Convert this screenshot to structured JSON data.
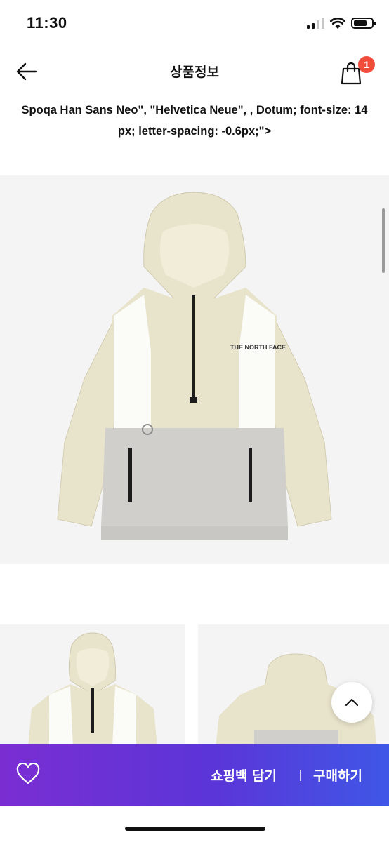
{
  "status_bar": {
    "time": "11:30"
  },
  "header": {
    "title": "상품정보",
    "cart_count": "1"
  },
  "description": {
    "line1": "Spoqa Han Sans Neo\", \"Helvetica Neue\", , Dotum; font-size: 14",
    "line2": "px; letter-spacing: -0.6px;\">"
  },
  "product": {
    "brand_mark": "THE NORTH FACE",
    "colors": {
      "body": "#e9e4cc",
      "panel": "#ffffff",
      "bottom": "#cfcecb",
      "zipper": "#1c1c1c"
    }
  },
  "bottom_bar": {
    "cart_label": "쇼핑백 담기",
    "buy_label": "구매하기",
    "gradient_start": "#7a2ed2",
    "gradient_end": "#3f57e6"
  },
  "icons": [
    "back-arrow-icon",
    "shopping-bag-icon",
    "heart-icon",
    "chevron-up-icon",
    "wifi-icon",
    "battery-icon",
    "signal-icon"
  ]
}
